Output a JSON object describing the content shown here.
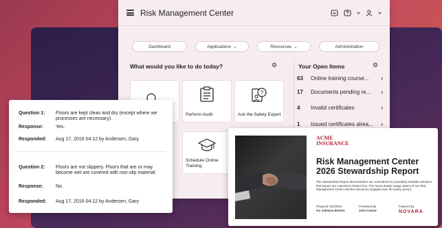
{
  "app": {
    "title": "Risk Management Center",
    "nav": [
      "Dashboard",
      "Applications",
      "Resources",
      "Administration"
    ],
    "today_title": "What would you like to do today?",
    "tiles": [
      "Perform Audit",
      "Ask the Safety Expert",
      "Schedule Online Training"
    ],
    "open_items_title": "Your Open Items",
    "open_items": [
      {
        "count": "63",
        "label": "Online training course..."
      },
      {
        "count": "17",
        "label": "Documents pending re..."
      },
      {
        "count": "4",
        "label": "Invalid certificates"
      },
      {
        "count": "1",
        "label": "Issued certificates alrea..."
      }
    ]
  },
  "questions": [
    {
      "q_label": "Question 1:",
      "q_text": "Floors are kept clean and dry (except where we processes are necessary).",
      "r_label": "Response:",
      "r_text": "Yes.",
      "d_label": "Responded:",
      "d_text": "Aug 17, 2016 04:12 by Andersen, Gary"
    },
    {
      "q_label": "Question 2:",
      "q_text": "Floors are not slippery. Floors that are or may become wet are covered with non-slip material.",
      "r_label": "Response:",
      "r_text": "No.",
      "d_label": "Responded:",
      "d_text": "Aug 17, 2016 04:12 by Andersen, Gary"
    }
  ],
  "report": {
    "brand_line1": "ACME",
    "brand_line2": "INSURANCE",
    "title": "Risk Management Center 2026 Stewardship Report",
    "description": "The Stewardship Report demonstrates our commitment to providing valuable solutions that impact our customer's bottom line. The report details usage statics of our Risk Management Center and the resources engaged over the policy period.",
    "prepared_label": "Prepared 1/02/2026",
    "prepared_value": "For Johnson Electric",
    "presented_label": "Presented By",
    "presented_value": "John Connor",
    "powered_label": "Powered By",
    "powered_value": "NOVARA"
  },
  "colors": {
    "accent": "#b0243a",
    "app_bg": "#f7ecef"
  }
}
